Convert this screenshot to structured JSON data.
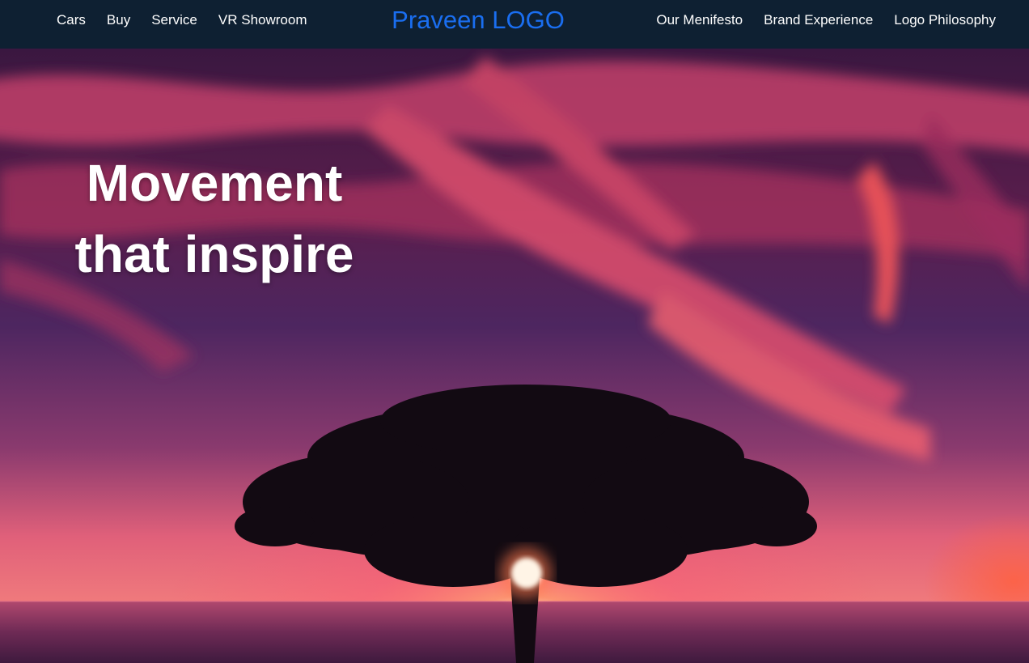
{
  "nav": {
    "left_links": [
      "Cars",
      "Buy",
      "Service",
      "VR Showroom"
    ],
    "logo": "Praveen LOGO",
    "right_links": [
      "Our Menifesto",
      "Brand Experience",
      "Logo Philosophy"
    ]
  },
  "hero": {
    "headline_line1": "Movement",
    "headline_line2": "that inspire",
    "image": "sunset-tree-over-sea"
  },
  "colors": {
    "nav_background": "#0e2032",
    "logo": "#1a6ef0",
    "nav_text": "#ffffff",
    "headline": "#ffffff"
  }
}
